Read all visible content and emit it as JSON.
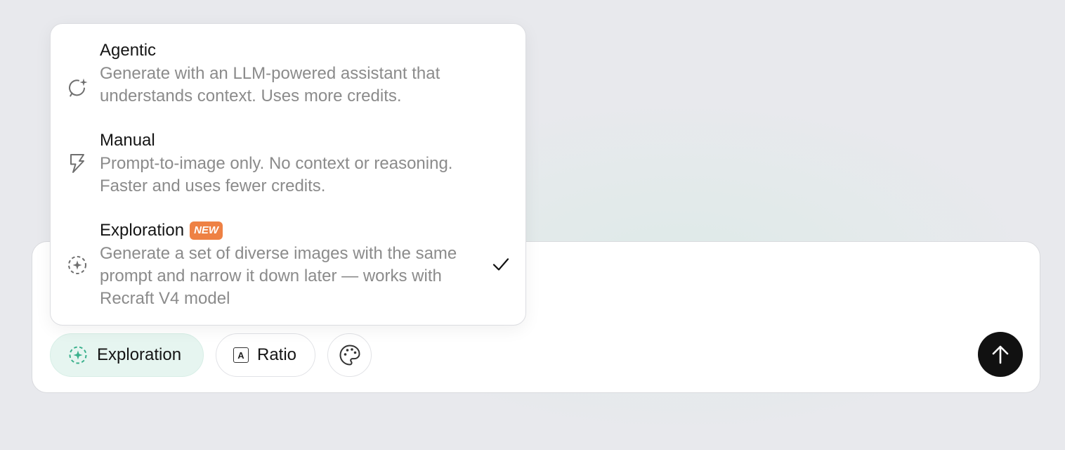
{
  "menu": {
    "items": [
      {
        "title": "Agentic",
        "description": "Generate with an LLM-powered assistant that understands context. Uses more credits.",
        "icon": "agentic-chat-sparkle-icon",
        "selected": false
      },
      {
        "title": "Manual",
        "description": "Prompt-to-image only. No context or reasoning. Faster and uses fewer credits.",
        "icon": "lightning-icon",
        "selected": false
      },
      {
        "title": "Exploration",
        "badge": "NEW",
        "description": "Generate a set of diverse images with the same prompt and narrow it down later — works with Recraft V4 model",
        "icon": "exploration-sparkle-icon",
        "selected": true
      }
    ]
  },
  "toolbar": {
    "mode_label": "Exploration",
    "ratio_label": "Ratio",
    "ratio_icon_text": "A"
  },
  "colors": {
    "accent": "#3ab08c",
    "badge": "#ee8144",
    "mode_pill_bg": "#e6f5f0",
    "send_button": "#111111"
  }
}
